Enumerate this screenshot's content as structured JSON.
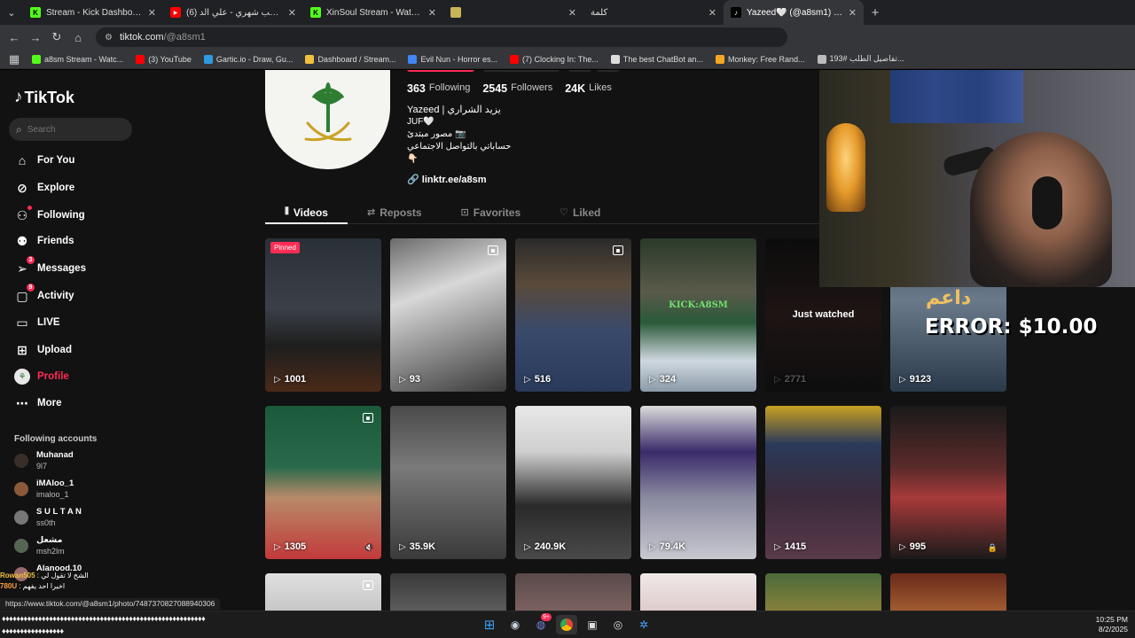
{
  "browser": {
    "tabs": [
      {
        "title": "Stream - Kick Dashboard",
        "favicon": "kick-icon",
        "color": "#53fc18",
        "active": false
      },
      {
        "title": "سلام واللعب شهري - علي الد (6)",
        "favicon": "youtube-icon",
        "color": "#ff0000",
        "active": false
      },
      {
        "title": "XinSoul Stream - Watch Live on",
        "favicon": "kick-icon",
        "color": "#53fc18",
        "active": false
      },
      {
        "title": "",
        "favicon": "wordle-icon",
        "color": "#c9b458",
        "active": false
      },
      {
        "title": "كلمة",
        "favicon": "",
        "color": "",
        "active": false
      },
      {
        "title": "Yazeed🤍 (@a8sm1) | TikTok",
        "favicon": "tiktok-icon",
        "color": "#000000",
        "active": true
      }
    ],
    "url_host": "tiktok.com",
    "url_path": "/@a8sm1",
    "bookmarks": [
      {
        "label": "a8sm Stream - Watc...",
        "color": "#53fc18"
      },
      {
        "label": "(3) YouTube",
        "color": "#ff0000"
      },
      {
        "label": "Gartic.io - Draw, Gu...",
        "color": "#2f9be0"
      },
      {
        "label": "Dashboard / Stream...",
        "color": "#f0c040"
      },
      {
        "label": "Evil Nun - Horror es...",
        "color": "#4285f4"
      },
      {
        "label": "(7) Clocking In: The...",
        "color": "#ff0000"
      },
      {
        "label": "The best ChatBot an...",
        "color": "#dddddd"
      },
      {
        "label": "Monkey: Free Rand...",
        "color": "#f5a623"
      },
      {
        "label": "تفاصيل الطلب #193...",
        "color": "#bbbbbb"
      }
    ]
  },
  "sidebar": {
    "logo": "TikTok",
    "search_placeholder": "Search",
    "items": [
      {
        "label": "For You",
        "icon": "home-icon",
        "badge": ""
      },
      {
        "label": "Explore",
        "icon": "compass-icon",
        "badge": ""
      },
      {
        "label": "Following",
        "icon": "following-icon",
        "badge": "dot"
      },
      {
        "label": "Friends",
        "icon": "friends-icon",
        "badge": ""
      },
      {
        "label": "Messages",
        "icon": "paper-plane-icon",
        "badge": "3"
      },
      {
        "label": "Activity",
        "icon": "inbox-icon",
        "badge": "9"
      },
      {
        "label": "LIVE",
        "icon": "live-icon",
        "badge": ""
      },
      {
        "label": "Upload",
        "icon": "plus-square-icon",
        "badge": ""
      },
      {
        "label": "Profile",
        "icon": "avatar",
        "badge": "",
        "active": true
      },
      {
        "label": "More",
        "icon": "more-icon",
        "badge": ""
      }
    ],
    "following_header": "Following accounts",
    "following": [
      {
        "name": "Muhanad",
        "handle": "9l7",
        "color": "#3a2f28"
      },
      {
        "name": "iMAloo_1",
        "handle": "imaloo_1",
        "color": "#8a5a3a"
      },
      {
        "name": "S U L T A N",
        "handle": "ss0th",
        "color": "#777777"
      },
      {
        "name": "مشعل",
        "handle": "msh2lm",
        "color": "#556655"
      },
      {
        "name": "Alanood.10",
        "handle": "",
        "color": "#9a6a6a"
      }
    ]
  },
  "profile": {
    "following_count": "363",
    "following_label": "Following",
    "followers_count": "2545",
    "followers_label": "Followers",
    "likes_count": "24K",
    "likes_label": "Likes",
    "bio_line1": "Yazeed | يزيد الشراري",
    "bio_line2": "JUF🤍",
    "bio_line3": "مصور مبتدئ 📷",
    "bio_line4": "حساباتي بالتواصل الاجتماعي",
    "bio_line5": "👇🏻",
    "link": "linktr.ee/a8sm",
    "tabs": [
      {
        "label": "Videos",
        "icon": "grid-icon",
        "active": true
      },
      {
        "label": "Reposts",
        "icon": "repost-icon",
        "active": false
      },
      {
        "label": "Favorites",
        "icon": "bookmark-icon",
        "active": false
      },
      {
        "label": "Liked",
        "icon": "heart-icon",
        "active": false
      }
    ]
  },
  "videos": [
    {
      "views": "1001",
      "badge": "Pinned",
      "photo": false,
      "bg": "linear-gradient(180deg,#2a3038 0%,#3b4048 45%,#1e1e1e 70%,#4a2a18 100%)"
    },
    {
      "views": "93",
      "badge": "",
      "photo": true,
      "bg": "linear-gradient(160deg,#6a6a6a 0%,#d8d8d8 35%,#9a9a9a 60%,#3a3a3a 100%)"
    },
    {
      "views": "516",
      "badge": "",
      "photo": true,
      "bg": "linear-gradient(180deg,#2a2a2a 0%,#5a4a3a 30%,#3a4a6a 60%,#2a3a5a 100%)"
    },
    {
      "views": "324",
      "badge": "",
      "photo": false,
      "bg": "linear-gradient(180deg,#2a3a2a 0%,#5a5a4a 35%,#2a5a3a 55%,#cfd8e0 80%,#8a9aa8 100%)",
      "caption": "KICK:A8SM"
    },
    {
      "views": "2771",
      "badge": "",
      "photo": false,
      "bg": "linear-gradient(180deg,#0c0c0c 0%,#1e1414 50%,#0e0e0e 100%)",
      "just_watched": "Just watched"
    },
    {
      "views": "9123",
      "badge": "",
      "photo": false,
      "bg": "linear-gradient(180deg,#3a4a5a 0%,#6a7a8a 40%,#2a3a4a 100%)",
      "overlay_ar": "اخر داعم"
    },
    {
      "views": "1305",
      "badge": "",
      "photo": true,
      "bg": "linear-gradient(180deg,#1a5a3a 0%,#2a6a4a 40%,#b88a6a 60%,#c23a3a 100%)",
      "muted": true
    },
    {
      "views": "35.9K",
      "badge": "",
      "photo": false,
      "bg": "linear-gradient(180deg,#4a4a4a 0%,#7a7a7a 40%,#3a3a3a 100%)"
    },
    {
      "views": "240.9K",
      "badge": "",
      "photo": false,
      "bg": "linear-gradient(180deg,#e8e8e8 0%,#cfcfcf 30%,#2a2a2a 65%,#4a4a4a 100%)"
    },
    {
      "views": "79.4K",
      "badge": "",
      "photo": false,
      "bg": "linear-gradient(180deg,#dcdcdc 0%,#3a2a6a 30%,#8a8aa0 60%,#c8c8d0 100%)"
    },
    {
      "views": "1415",
      "badge": "",
      "photo": false,
      "bg": "linear-gradient(180deg,#c8a020 0%,#2a3a5a 25%,#3a2a3a 60%,#5a3a4a 100%)"
    },
    {
      "views": "995",
      "badge": "",
      "photo": false,
      "bg": "linear-gradient(180deg,#1a1a1a 0%,#5a2a2a 40%,#a83a3a 60%,#1a1a1a 100%)",
      "locked": true
    },
    {
      "views": "",
      "badge": "",
      "photo": true,
      "bg": "linear-gradient(180deg,#e0e0e0 0%,#bcbcbc 100%)"
    },
    {
      "views": "",
      "badge": "",
      "photo": false,
      "bg": "linear-gradient(180deg,#3a3a3a 0%,#6a6a6a 100%)"
    },
    {
      "views": "",
      "badge": "",
      "photo": false,
      "bg": "linear-gradient(180deg,#5a4a4a 0%,#8a6a6a 100%)"
    },
    {
      "views": "",
      "badge": "",
      "photo": false,
      "bg": "linear-gradient(180deg,#f0e8e8 0%,#d8c0c0 100%)"
    },
    {
      "views": "",
      "badge": "",
      "photo": false,
      "bg": "linear-gradient(180deg,#4a6a3a 0%,#a08a3a 100%)"
    },
    {
      "views": "",
      "badge": "",
      "photo": false,
      "bg": "linear-gradient(180deg,#6a2a1a 0%,#b8703a 100%)"
    }
  ],
  "overlay": {
    "error_text": "ERROR: $10.00"
  },
  "status_url": "https://www.tiktok.com/@a8sm1/photo/7487370827088940306",
  "chat": [
    {
      "user": "Rowan505",
      "text": "الشخ لا تقول لي"
    },
    {
      "user": "780U",
      "text": "اخيرا احد يفهم"
    }
  ],
  "taskbar": {
    "time": "10:25 PM",
    "date": "8/2/2025",
    "left_text_1": "♦♦♦♦♦♦♦♦♦♦♦♦♦♦♦♦♦♦♦♦♦♦♦♦♦♦♦♦♦♦♦♦♦♦♦♦♦♦♦♦♦♦♦♦♦♦♦♦♦♦♦♦♦♦♦♦",
    "left_text_2": "♦♦♦♦♦♦♦♦♦♦♦♦♦♦♦♦♦"
  }
}
